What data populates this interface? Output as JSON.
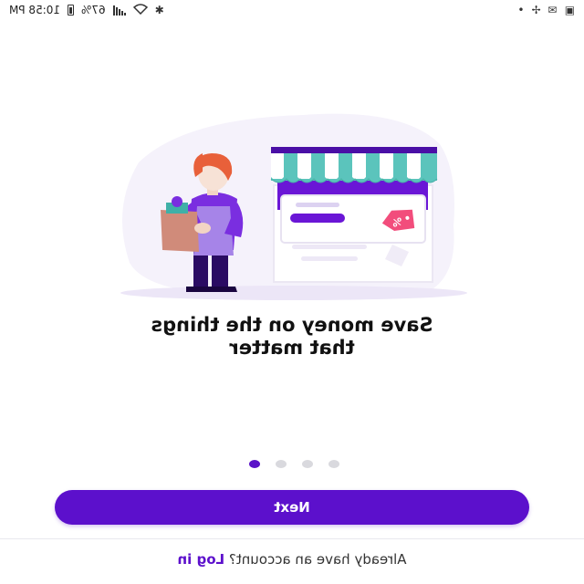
{
  "status_bar": {
    "time": "10:58 PM",
    "battery": "67%",
    "icons": [
      "battery-icon",
      "signal-icon",
      "wifi-icon",
      "bluetooth-icon",
      "gallery-icon",
      "gmail-icon",
      "fan-icon",
      "more-icon"
    ]
  },
  "onboarding": {
    "headline_line1": "Save money on the things",
    "headline_line2": "that matter",
    "discount_tag": "%",
    "page_count": 4,
    "current_page": 1
  },
  "actions": {
    "next_label": "Next",
    "login_prompt": "Already have an account?",
    "login_link": "Log in"
  },
  "colors": {
    "primary": "#5c10cc",
    "awning_teal": "#5bc4bc",
    "tag_pink": "#f24d7c",
    "hair": "#e8603a"
  }
}
